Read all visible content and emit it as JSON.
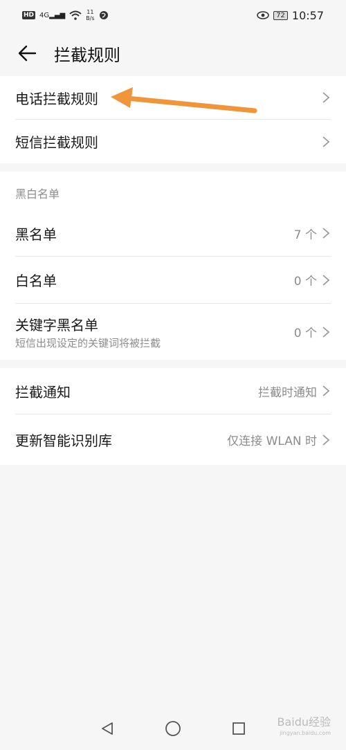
{
  "status_bar": {
    "hd": "HD",
    "signal": "4G",
    "net_speed_value": "11",
    "net_speed_unit": "B/s",
    "battery": "72",
    "time": "10:57"
  },
  "header": {
    "title": "拦截规则"
  },
  "rules": [
    {
      "label": "电话拦截规则"
    },
    {
      "label": "短信拦截规则"
    }
  ],
  "lists_section": {
    "header": "黑白名单",
    "items": [
      {
        "label": "黑名单",
        "value": "7 个"
      },
      {
        "label": "白名单",
        "value": "0 个"
      },
      {
        "label": "关键字黑名单",
        "sublabel": "短信出现设定的关键词将被拦截",
        "value": "0 个"
      }
    ]
  },
  "other": [
    {
      "label": "拦截通知",
      "value": "拦截时通知"
    },
    {
      "label": "更新智能识别库",
      "value": "仅连接 WLAN 时"
    }
  ],
  "watermark": {
    "text": "Baidu经验",
    "sub": "jingyan.baidu.com"
  },
  "colors": {
    "annotation_arrow": "#f0953a",
    "background": "#f6f6f6",
    "card": "#ffffff"
  }
}
